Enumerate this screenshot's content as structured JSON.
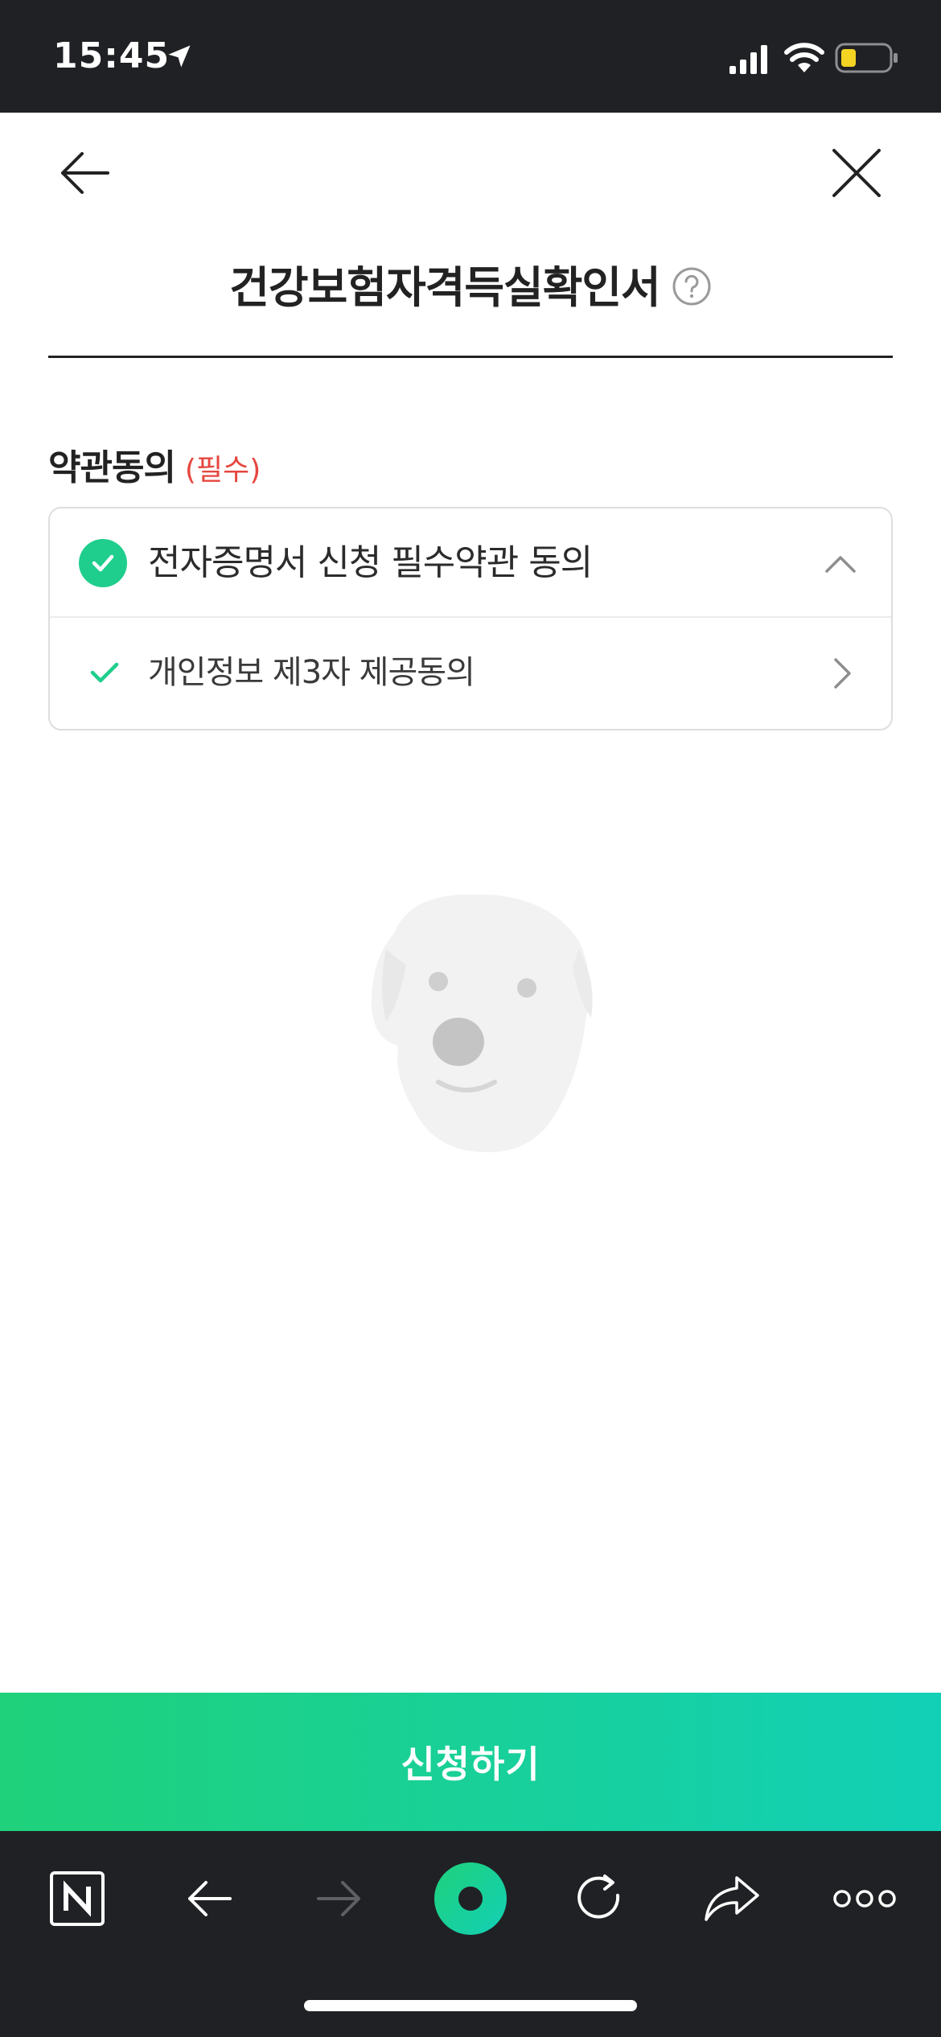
{
  "status_bar": {
    "time": "15:45",
    "icons": [
      "location-arrow-icon",
      "cellular-signal-icon",
      "wifi-icon",
      "battery-low-icon"
    ],
    "battery_color": "#f5d323"
  },
  "header": {
    "title": "건강보험자격득실확인서",
    "back_icon": "arrow-left-icon",
    "close_icon": "close-icon",
    "help_icon": "question-circle-icon"
  },
  "terms": {
    "section_title": "약관동의",
    "required_label": "(필수)",
    "main_item": {
      "label": "전자증명서 신청 필수약관 동의",
      "checked": true
    },
    "sub_items": [
      {
        "label": "개인정보 제3자 제공동의",
        "checked": true
      }
    ]
  },
  "loading": {
    "image": "dog-face-loading-image"
  },
  "apply_button": {
    "label": "신청하기"
  },
  "toolbar": {
    "items": [
      "naver-home-icon",
      "back-arrow-icon",
      "forward-arrow-icon",
      "green-dot-icon",
      "refresh-icon",
      "share-icon",
      "more-icon"
    ]
  },
  "colors": {
    "accent_green": "#1fce8c",
    "required_red": "#e5473f",
    "dark_bar": "#202124"
  }
}
